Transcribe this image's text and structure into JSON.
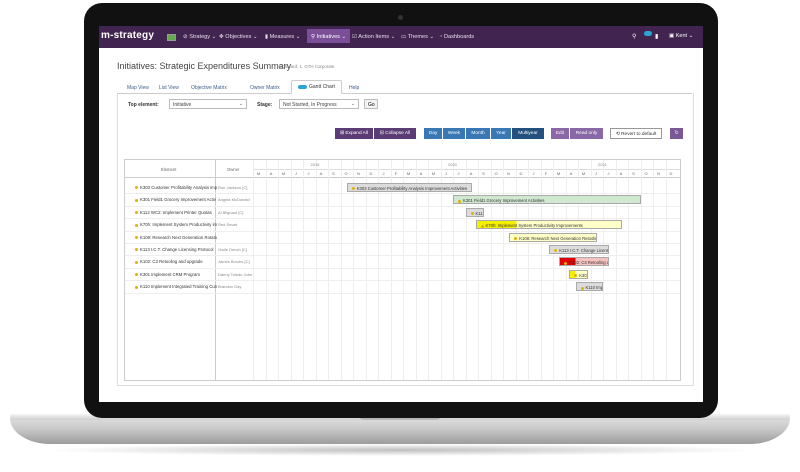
{
  "nav": {
    "brand": "m-strategy",
    "items": [
      "Strategy",
      "Objectives",
      "Measures",
      "Initiatives",
      "Action Items",
      "Themes",
      "Dashboards"
    ],
    "user": "Kent"
  },
  "page": {
    "title": "Initiatives: Strategic Expenditures Summary",
    "subtitle": "Scorecard: 1. GTH Corporate"
  },
  "tabs": [
    "Map View",
    "List View",
    "Objective Matrix",
    "Owner Matrix",
    "Gantt Chart",
    "Help"
  ],
  "filters": {
    "top_element_label": "Top element:",
    "top_element_value": "Initiative",
    "stage_label": "Stage:",
    "stage_value": "Not Started, In Progress",
    "go_label": "Go"
  },
  "toolbar": {
    "expand_all": "Expand All",
    "collapse_all": "Collapse All",
    "day": "Day",
    "week": "Week",
    "month": "Month",
    "year": "Year",
    "multiyear": "Multiyear",
    "edit": "Edit",
    "read_only": "Read only",
    "revert": "Revert to default"
  },
  "gantt": {
    "col_element": "Element",
    "col_owner": "Owner",
    "years": [
      "2019",
      "2020",
      "2021"
    ],
    "months": [
      "M",
      "A",
      "M",
      "J",
      "J",
      "A",
      "S",
      "O",
      "N",
      "D",
      "J",
      "F",
      "M",
      "A",
      "M",
      "J",
      "J",
      "A",
      "S",
      "O",
      "N",
      "D",
      "J",
      "F",
      "M",
      "A",
      "M",
      "J",
      "J",
      "A",
      "S",
      "O",
      "N",
      "D"
    ],
    "rows": [
      {
        "element": "K303 Customer Profitability Analysis imp",
        "owner": "Ron Jackson [C]",
        "bar": "K303 Customer Profitability Analysis Improvement Activities",
        "start": 7.5,
        "end": 17.5,
        "color": "#dcdcdc"
      },
      {
        "element": "K301 Field1 Grocery Improvement Activ",
        "owner": "Angela McDonald",
        "bar": "K301 Field1 Grocery Improvement Activities",
        "start": 16.0,
        "end": 31.0,
        "color": "#cfe8cf"
      },
      {
        "element": "K112 WC2: Implement Printer Quotas",
        "owner": "Al Blignaut [C]",
        "bar": "K112 WC2",
        "start": 17.0,
        "end": 18.5,
        "color": "#dcdcdc"
      },
      {
        "element": "K70h: Implement System Productivity im",
        "owner": "Red Smart",
        "bar": "K70h: Implement System Productivity Improvements",
        "start": 17.8,
        "end": 29.5,
        "color": "#ffffc8",
        "accent": "#f5ef00",
        "accent_end": 21.0
      },
      {
        "element": "K108: Research Next Generation Rotatio",
        "owner": "",
        "bar": "K108: Research Next Generation Retooling Machin",
        "start": 20.5,
        "end": 27.5,
        "color": "#ffffc8"
      },
      {
        "element": "K113 I.C.T. Change Licensing Protocol",
        "owner": "Gwile Dench [C]",
        "bar": "K113 I.C.T. Change Licensing Protocol",
        "start": 23.7,
        "end": 28.5,
        "color": "#dcdcdc"
      },
      {
        "element": "K102: C3 Retooling and upgrade",
        "owner": "James Brooks [C]",
        "bar": "K102: C3 Retooling and upgrade",
        "start": 24.5,
        "end": 28.5,
        "color": "#f6c1c1",
        "accent": "#e00000",
        "accent_end": 25.8
      },
      {
        "element": "K301 Implement CRM Program",
        "owner": "Danny Toledo John",
        "bar": "K301 Imp",
        "start": 25.3,
        "end": 26.8,
        "color": "#ffffc8",
        "accent": "#f5ef00",
        "accent_end": 25.8
      },
      {
        "element": "K110 Implement Integrated Training Curr",
        "owner": "Brandon Day",
        "bar": "K110 Implement",
        "start": 25.8,
        "end": 28.0,
        "color": "#dcdcdc"
      }
    ]
  }
}
